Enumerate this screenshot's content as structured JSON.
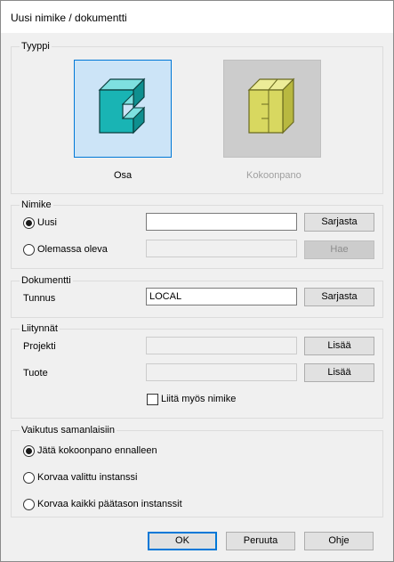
{
  "window": {
    "title": "Uusi nimike / dokumentti"
  },
  "tyyppi": {
    "legend": "Tyyppi",
    "options": [
      {
        "label": "Osa",
        "icon": "part-icon",
        "selected": true
      },
      {
        "label": "Kokoonpano",
        "icon": "assembly-icon",
        "disabled": true
      }
    ]
  },
  "nimike": {
    "legend": "Nimike",
    "uusi_label": "Uusi",
    "uusi_value": "",
    "sarjasta": "Sarjasta",
    "olemassa_label": "Olemassa oleva",
    "olemassa_value": "",
    "hae": "Hae",
    "selected": "Uusi"
  },
  "dokumentti": {
    "legend": "Dokumentti",
    "tunnus_label": "Tunnus",
    "tunnus_value": "LOCAL",
    "sarjasta": "Sarjasta"
  },
  "liitynnat": {
    "legend": "Liitynnät",
    "projekti_label": "Projekti",
    "projekti_value": "",
    "projekti_button": "Lisää",
    "tuote_label": "Tuote",
    "tuote_value": "",
    "tuote_button": "Lisää",
    "liita_label": "Liitä myös nimike",
    "liita_checked": false
  },
  "vaikutus": {
    "legend": "Vaikutus samanlaisiin",
    "options": [
      {
        "label": "Jätä kokoonpano ennalleen",
        "selected": true
      },
      {
        "label": "Korvaa valittu instanssi",
        "selected": false
      },
      {
        "label": "Korvaa kaikki päätason instanssit",
        "selected": false
      }
    ]
  },
  "buttons": {
    "ok": "OK",
    "peruuta": "Peruuta",
    "ohje": "Ohje"
  },
  "colors": {
    "accent": "#0078d7",
    "selected_bg": "#cce4f7",
    "part_teal": "#19b4b4",
    "assembly_yellow": "#d8d860"
  }
}
